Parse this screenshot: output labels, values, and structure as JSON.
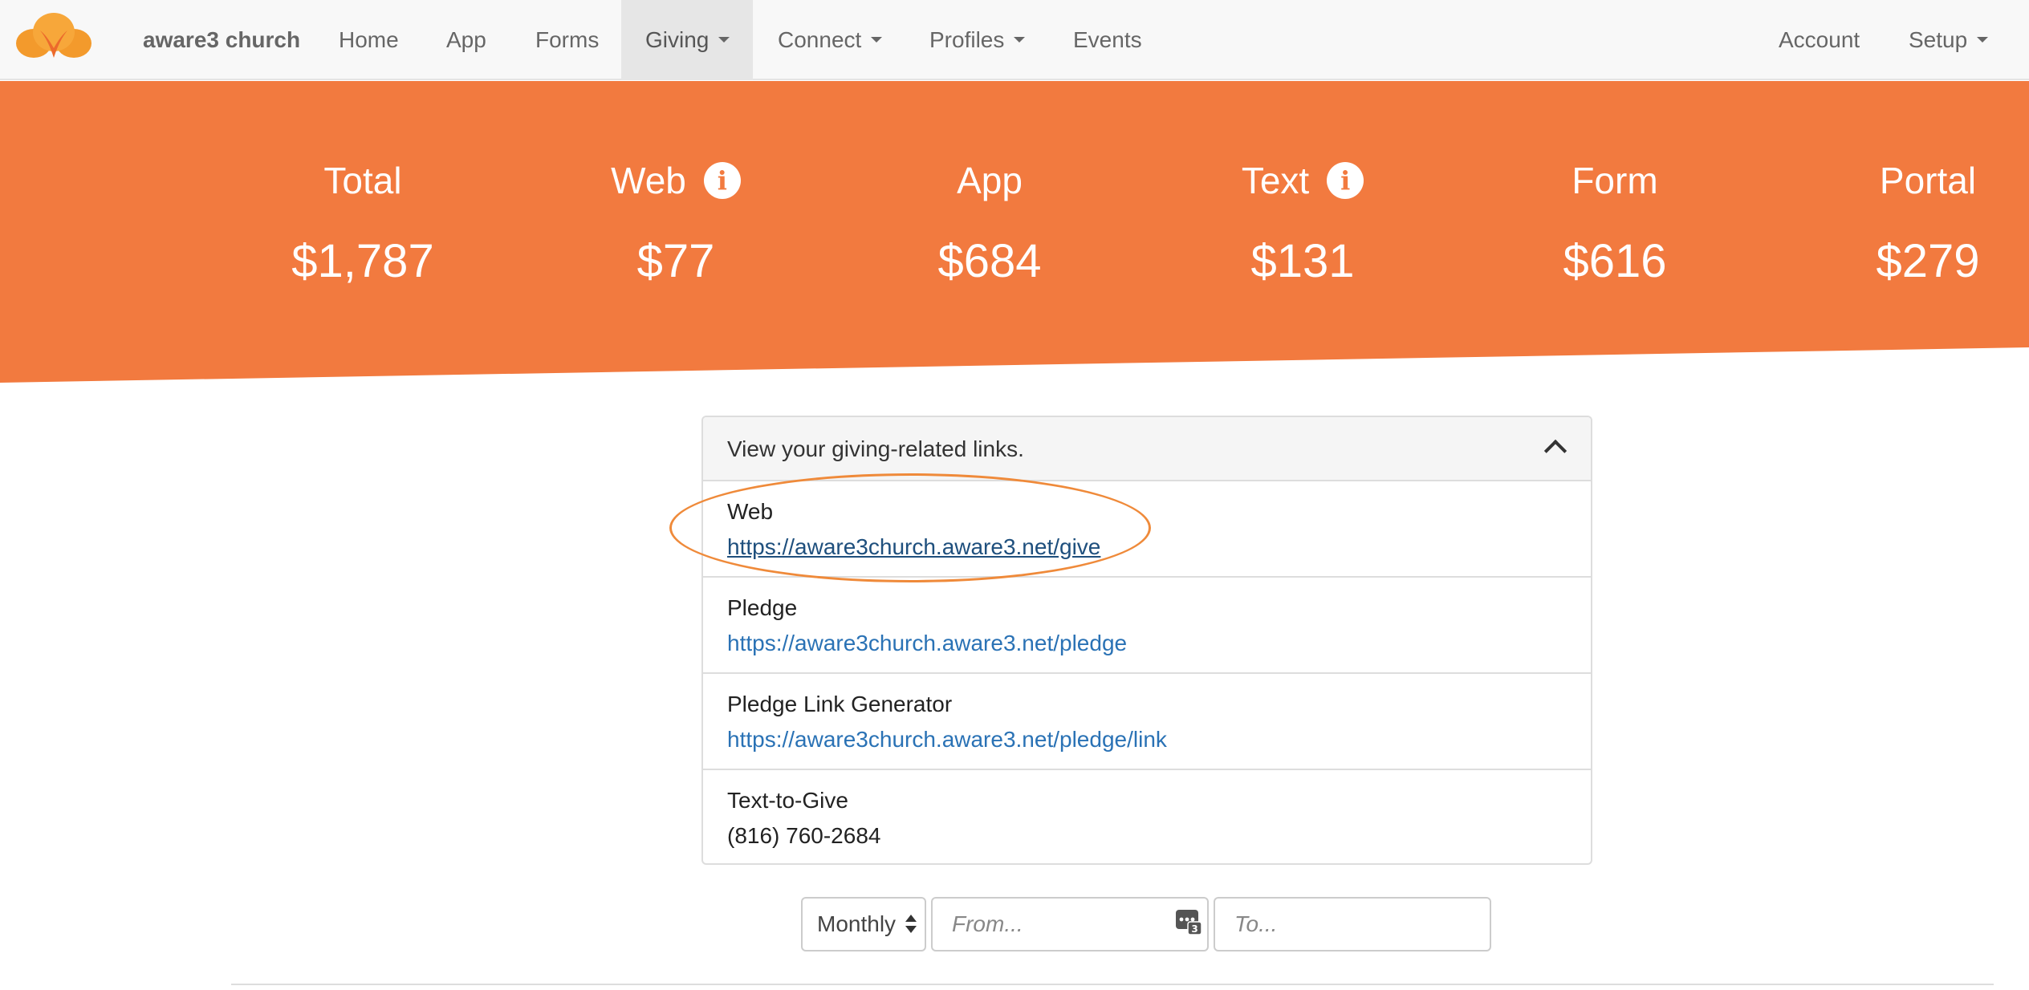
{
  "nav": {
    "brand": "aware3 church",
    "items": [
      {
        "label": "Home"
      },
      {
        "label": "App"
      },
      {
        "label": "Forms"
      },
      {
        "label": "Giving"
      },
      {
        "label": "Connect"
      },
      {
        "label": "Profiles"
      },
      {
        "label": "Events"
      }
    ],
    "right": [
      {
        "label": "Account"
      },
      {
        "label": "Setup"
      }
    ],
    "active": "Giving"
  },
  "stats": [
    {
      "label": "Total",
      "value": "$1,787"
    },
    {
      "label": "Web",
      "value": "$77"
    },
    {
      "label": "App",
      "value": "$684"
    },
    {
      "label": "Text",
      "value": "$131"
    },
    {
      "label": "Form",
      "value": "$616"
    },
    {
      "label": "Portal",
      "value": "$279"
    }
  ],
  "links_panel": {
    "title": "View your giving-related links.",
    "rows": [
      {
        "label": "Web",
        "value": "https://aware3church.aware3.net/give"
      },
      {
        "label": "Pledge",
        "value": "https://aware3church.aware3.net/pledge"
      },
      {
        "label": "Pledge Link Generator",
        "value": "https://aware3church.aware3.net/pledge/link"
      },
      {
        "label": "Text-to-Give",
        "value": "(816) 760-2684"
      }
    ]
  },
  "filters": {
    "period": "Monthly",
    "from_placeholder": "From...",
    "to_placeholder": "To...",
    "calendar_badge": "3"
  },
  "colors": {
    "accent": "#f27a3f",
    "link": "#2a72b5",
    "highlight": "#ef8a3a"
  }
}
